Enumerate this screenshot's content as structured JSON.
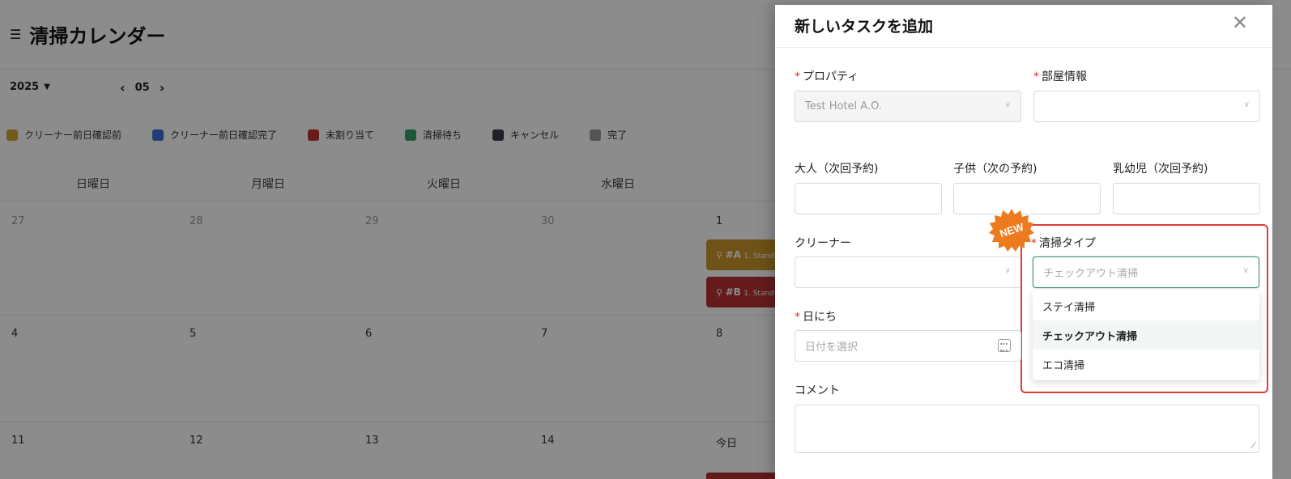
{
  "calendar": {
    "title": "清掃カレンダー",
    "year": "2025",
    "month": "05",
    "legend": [
      {
        "label": "クリーナー前日確認前",
        "color": "#d4a42c"
      },
      {
        "label": "クリーナー前日確認完了",
        "color": "#3b6fd8"
      },
      {
        "label": "未割り当て",
        "color": "#c23434"
      },
      {
        "label": "清掃待ち",
        "color": "#34a06a"
      },
      {
        "label": "キャンセル",
        "color": "#3a3f4a"
      },
      {
        "label": "完了",
        "color": "#9a9a9a"
      }
    ],
    "weekdays": [
      "日曜日",
      "月曜日",
      "火曜日",
      "水曜日"
    ],
    "week1": [
      "27",
      "28",
      "29",
      "30",
      "1"
    ],
    "week2": [
      "4",
      "5",
      "6",
      "7",
      "8"
    ],
    "week3": [
      "11",
      "12",
      "13",
      "14",
      "今日"
    ],
    "events": [
      {
        "code": "#A",
        "text": "1. Stand",
        "color": "#c8962a"
      },
      {
        "code": "#B",
        "text": "1. Stand",
        "color": "#b83232"
      }
    ]
  },
  "drawer": {
    "title": "新しいタスクを追加",
    "property": {
      "label": "プロパティ",
      "value": "Test Hotel A.O."
    },
    "room": {
      "label": "部屋情報",
      "value": ""
    },
    "adults": {
      "label": "大人（次回予約)"
    },
    "children": {
      "label": "子供（次の予約)"
    },
    "infants": {
      "label": "乳幼児（次回予約)"
    },
    "cleaner": {
      "label": "クリーナー",
      "value": ""
    },
    "cleaning_type": {
      "label": "清掃タイプ",
      "placeholder": "チェックアウト清掃",
      "options": [
        "ステイ清掃",
        "チェックアウト清掃",
        "エコ清掃"
      ],
      "active_option": "チェックアウト清掃"
    },
    "date": {
      "label": "日にち",
      "placeholder": "日付を選択"
    },
    "comment": {
      "label": "コメント"
    },
    "badge": "NEW"
  }
}
